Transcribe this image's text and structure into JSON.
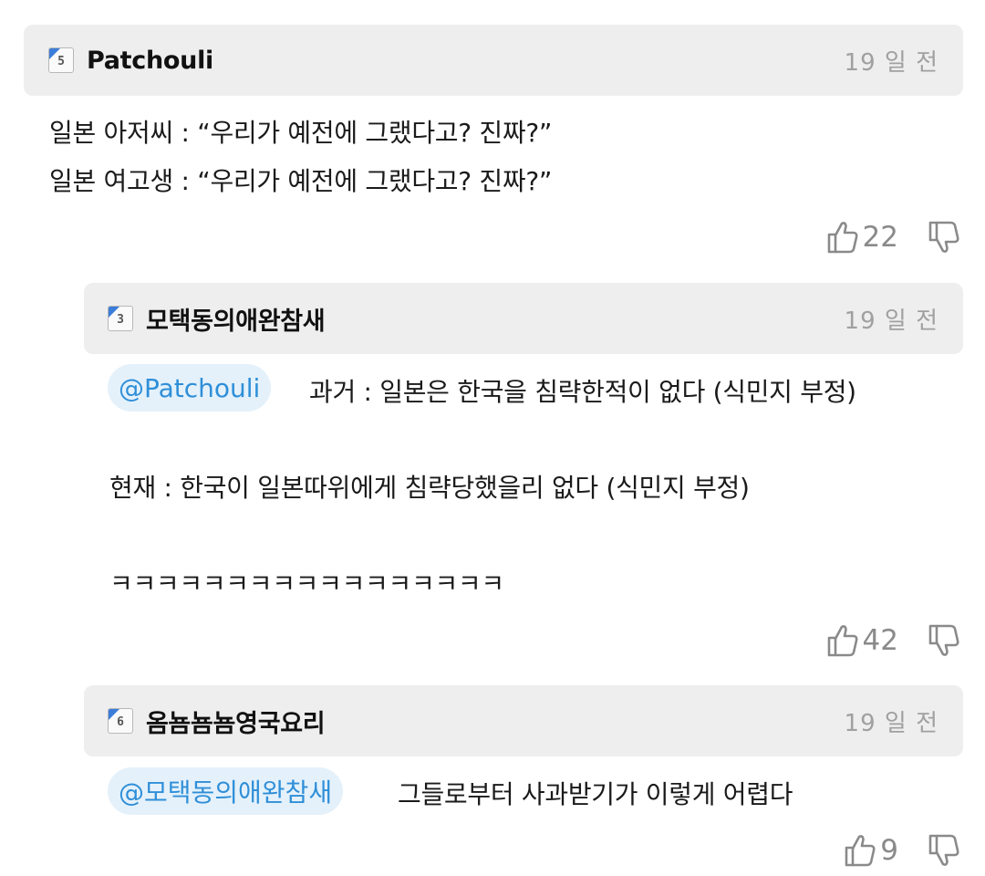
{
  "comments": [
    {
      "level": "5",
      "username": "Patchouli",
      "time": "19 일 전",
      "lines": [
        "일본 아저씨 : “우리가 예전에 그랬다고? 진짜?”",
        "일본 여고생 : “우리가 예전에 그랬다고? 진짜?”"
      ],
      "likes": "22"
    },
    {
      "level": "3",
      "username": "모택동의애완참새",
      "time": "19 일 전",
      "mention": "@Patchouli",
      "lines": [
        "과거 : 일본은 한국을 침략한적이 없다 (식민지 부정)",
        "현재 : 한국이 일본따위에게 침략당했을리 없다 (식민지 부정)",
        "ㅋㅋㅋㅋㅋㅋㅋㅋㅋㅋㅋㅋㅋㅋㅋㅋㅋ"
      ],
      "likes": "42"
    },
    {
      "level": "6",
      "username": "옴뇸뇸뇸영국요리",
      "time": "19 일 전",
      "mention": "@모택동의애완참새",
      "lines": [
        "그들로부터 사과받기가 이렇게 어렵다"
      ],
      "likes": "9"
    }
  ],
  "icons": {
    "like": "thumbs-up-icon",
    "dislike": "thumbs-down-icon",
    "level": "level-badge-icon"
  },
  "colors": {
    "mention_text": "#2f8fd8",
    "mention_bg": "#e4f1fb",
    "badge_corner": "#3b7dd8",
    "header_bg": "#eeeeee"
  }
}
